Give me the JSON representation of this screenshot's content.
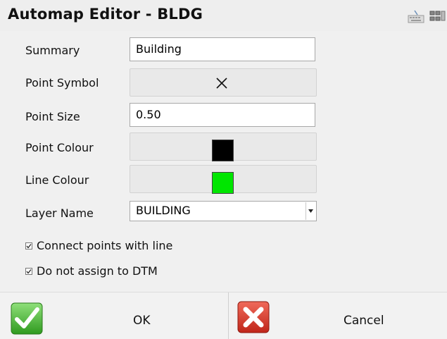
{
  "window": {
    "title": "Automap Editor - BLDG"
  },
  "toolbar": {
    "keyboard_icon": "keyboard-icon",
    "grid_icon": "grid-icon"
  },
  "form": {
    "summary_label": "Summary",
    "summary_value": "Building",
    "point_symbol_label": "Point Symbol",
    "point_symbol_value": "×",
    "point_size_label": "Point Size",
    "point_size_value": "0.50",
    "point_colour_label": "Point Colour",
    "point_colour": "#000000",
    "line_colour_label": "Line Colour",
    "line_colour": "#00e600",
    "layer_name_label": "Layer Name",
    "layer_name_value": "BUILDING"
  },
  "options": {
    "connect_points_label": "Connect points with line",
    "connect_points_checked": true,
    "no_dtm_label": "Do not assign to DTM",
    "no_dtm_checked": true
  },
  "actions": {
    "ok_label": "OK",
    "cancel_label": "Cancel"
  }
}
